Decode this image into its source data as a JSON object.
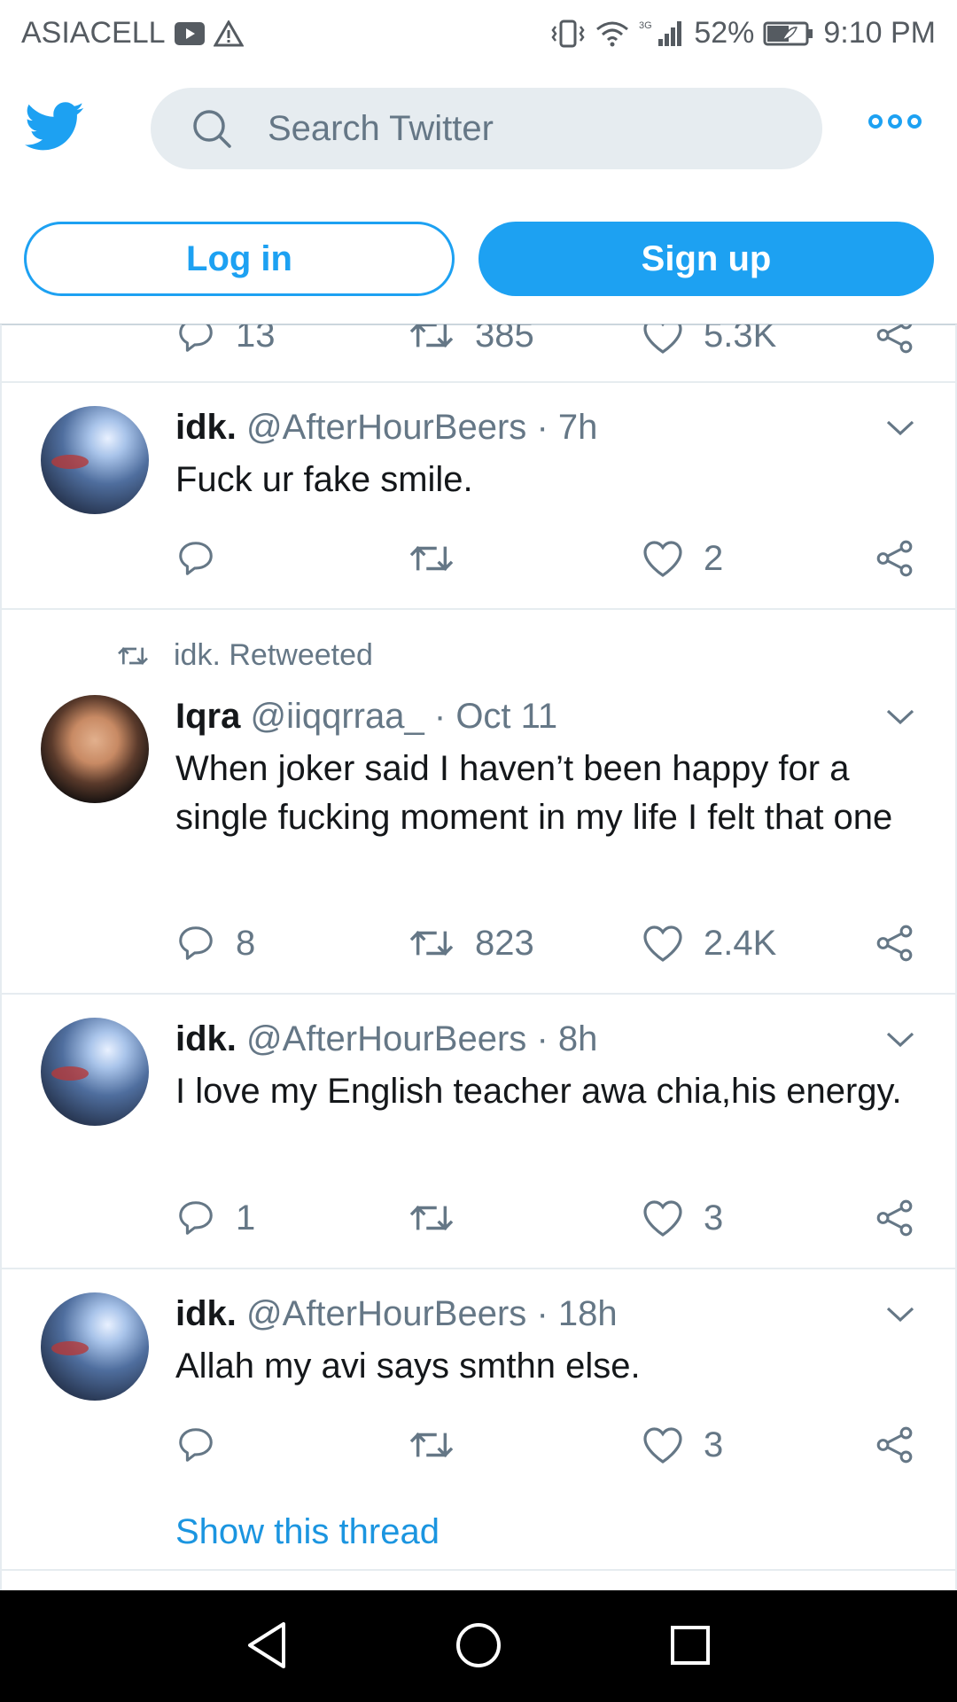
{
  "status_bar": {
    "carrier": "ASIACELL",
    "network": "3G",
    "battery": "52%",
    "time": "9:10 PM"
  },
  "header": {
    "search_placeholder": "Search Twitter",
    "login_label": "Log in",
    "signup_label": "Sign up"
  },
  "colors": {
    "accent": "#1da1f2",
    "text": "#14171a",
    "secondary": "#657786",
    "divider": "#e6ecf0"
  },
  "partial_actions": {
    "reply_count": "13",
    "retweet_count": "385",
    "like_count": "5.3K"
  },
  "tweets": [
    {
      "name": "idk.",
      "handle": "@AfterHourBeers",
      "time": "7h",
      "text": "Fuck ur fake smile.",
      "reply_count": "",
      "retweet_count": "",
      "like_count": "2"
    },
    {
      "retweeted_by": "idk. Retweeted",
      "name": "Iqra",
      "handle": "@iiqqrraa_",
      "time": "Oct 11",
      "text": "When joker said I haven’t been happy for a single fucking moment in my life I felt that one",
      "reply_count": "8",
      "retweet_count": "823",
      "like_count": "2.4K"
    },
    {
      "name": "idk.",
      "handle": "@AfterHourBeers",
      "time": "8h",
      "text": "I love my English teacher awa chia,his energy.",
      "reply_count": "1",
      "retweet_count": "",
      "like_count": "3"
    },
    {
      "name": "idk.",
      "handle": "@AfterHourBeers",
      "time": "18h",
      "text": "Allah my avi says smthn else.",
      "reply_count": "",
      "retweet_count": "",
      "like_count": "3",
      "show_thread": "Show this thread"
    }
  ],
  "icons": {
    "logo": "twitter-bird-icon",
    "search": "search-icon",
    "more": "more-options-icon",
    "reply": "reply-icon",
    "retweet": "retweet-icon",
    "like": "heart-icon",
    "share": "share-icon",
    "chevron": "chevron-down-icon",
    "nav_back": "back-triangle-icon",
    "nav_home": "home-circle-icon",
    "nav_recents": "recents-square-icon"
  }
}
